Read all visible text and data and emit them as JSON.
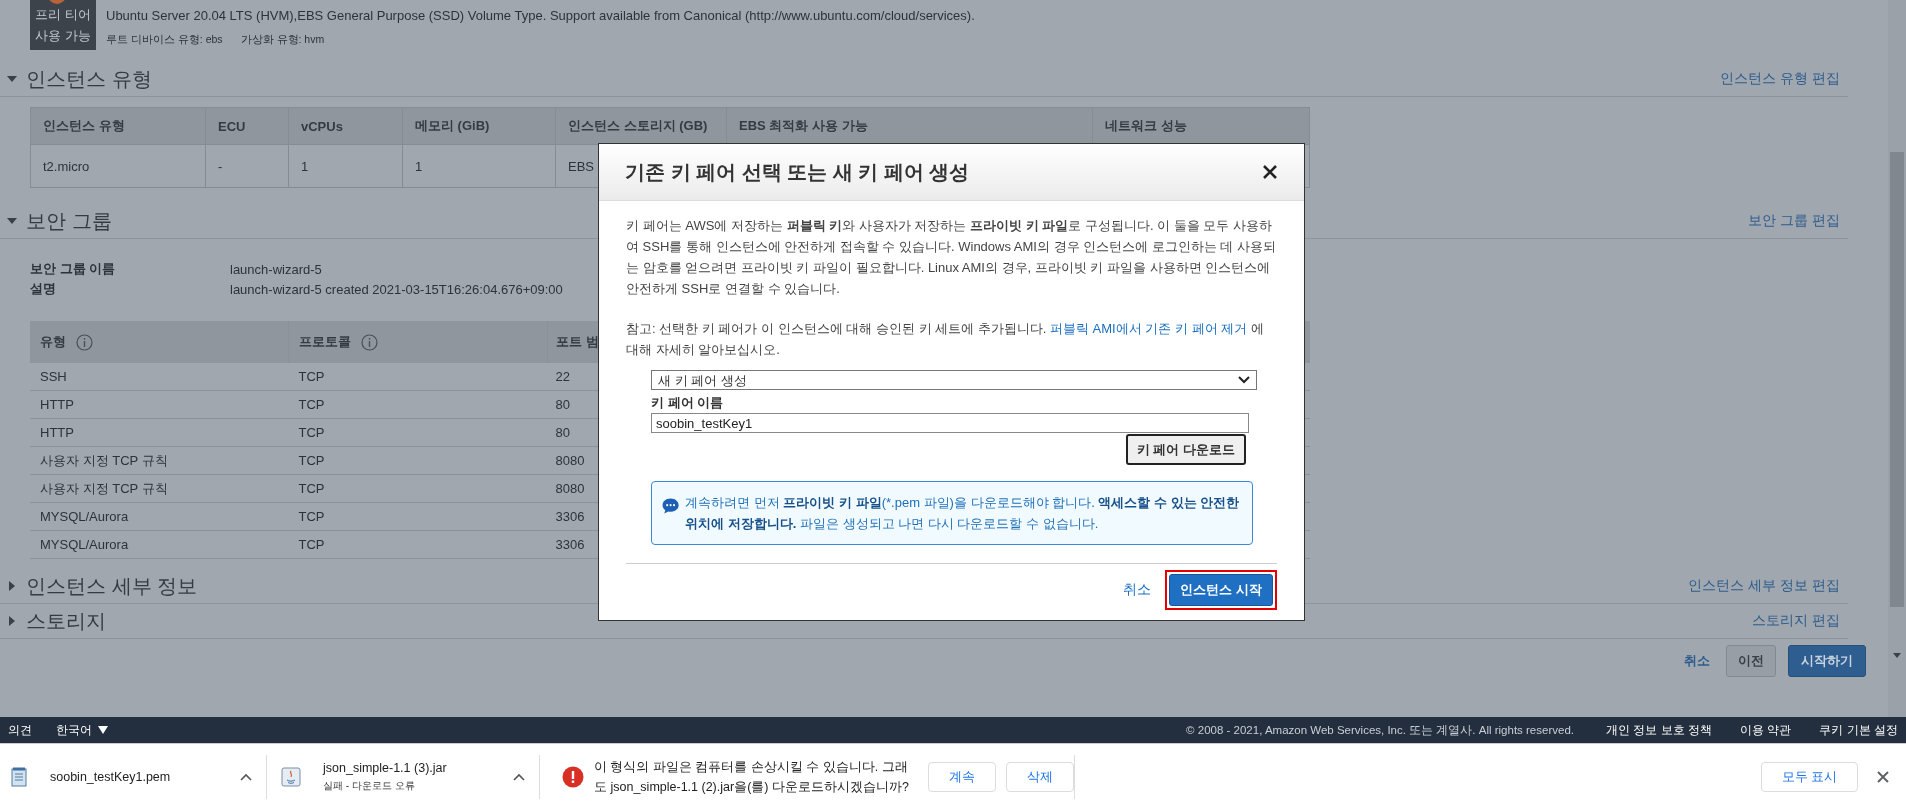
{
  "ami": {
    "badge": [
      "프리 티어",
      "사용 가능"
    ],
    "description": "Ubuntu Server 20.04 LTS (HVM),EBS General Purpose (SSD) Volume Type. Support available from Canonical (http://www.ubuntu.com/cloud/services).",
    "meta": [
      "루트 디바이스 유형: ebs",
      "가상화 유형: hvm"
    ]
  },
  "sections": [
    {
      "kind": "instance_type",
      "title": "인스턴스 유형",
      "expanded": true,
      "edit_link": "인스턴스 유형 편집",
      "table": {
        "columns": [
          "인스턴스 유형",
          "ECU",
          "vCPUs",
          "메모리 (GiB)",
          "인스턴스 스토리지 (GB)",
          "EBS 최적화 사용 가능",
          "네트워크 성능"
        ],
        "rows": [
          [
            "t2.micro",
            "-",
            "1",
            "1",
            "EBS"
          ]
        ]
      }
    },
    {
      "kind": "security_group",
      "title": "보안 그룹",
      "expanded": true,
      "edit_link": "보안 그룹 편집",
      "info": [
        {
          "label": "보안 그룹 이름",
          "value": "launch-wizard-5"
        },
        {
          "label": "설명",
          "value": "launch-wizard-5 created 2021-03-15T16:26:04.676+09:00"
        }
      ],
      "table": {
        "columns": [
          {
            "label": "유형",
            "info": true
          },
          {
            "label": "프로토콜",
            "info": true
          },
          {
            "label": "포트 범",
            "info": false
          }
        ],
        "rows": [
          [
            "SSH",
            "TCP",
            "22"
          ],
          [
            "HTTP",
            "TCP",
            "80"
          ],
          [
            "HTTP",
            "TCP",
            "80"
          ],
          [
            "사용자 지정 TCP 규칙",
            "TCP",
            "8080"
          ],
          [
            "사용자 지정 TCP 규칙",
            "TCP",
            "8080"
          ],
          [
            "MYSQL/Aurora",
            "TCP",
            "3306"
          ],
          [
            "MYSQL/Aurora",
            "TCP",
            "3306"
          ]
        ]
      }
    },
    {
      "title": "인스턴스 세부 정보",
      "expanded": false,
      "edit_link": "인스턴스 세부 정보 편집"
    },
    {
      "title": "스토리지",
      "expanded": false,
      "edit_link": "스토리지 편집"
    }
  ],
  "wizard_buttons": {
    "cancel": "취소",
    "previous": "이전",
    "launch": "시작하기"
  },
  "modal": {
    "title": "기존 키 페어 선택 또는 새 키 페어 생성",
    "intro": "키 페어는 AWS에 저장하는 **퍼블릭 키**와 사용자가 저장하는 **프라이빗 키 파일**로 구성됩니다. 이 둘을 모두 사용하여 SSH를 통해 인스턴스에 안전하게 접속할 수 있습니다. Windows AMI의 경우 인스턴스에 로그인하는 데 사용되는 암호를 얻으려면 프라이빗 키 파일이 필요합니다. Linux AMI의 경우, 프라이빗 키 파일을 사용하면 인스턴스에 안전하게 SSH로 연결할 수 있습니다.",
    "note": {
      "before": "참고: 선택한 키 페어가 이 인스턴스에 대해 승인된 키 세트에 추가됩니다.",
      "link": "퍼블릭 AMI에서 기존 키 페어 제거",
      "after": "에 대해 자세히 알아보십시오."
    },
    "key_pair_select": {
      "value": "새 키 페어 생성"
    },
    "name_label": "키 페어 이름",
    "name_field": {
      "value": "soobin_testKey1"
    },
    "download_button": "키 페어 다운로드",
    "info": [
      {
        "text": "계속하려면 먼저 ",
        "bold": false
      },
      {
        "text": "프라이빗 키 파일",
        "bold": true
      },
      {
        "text": "(*.pem 파일)을 다운로드해야 합니다. ",
        "bold": false
      },
      {
        "text": "액세스할 수 있는 안전한 위치에 저장합니다.",
        "bold": true
      },
      {
        "text": " 파일은 생성되고 나면 다시 다운로드할 수 없습니다.",
        "bold": false
      }
    ],
    "cancel": "취소",
    "launch": "인스턴스 시작",
    "launch_highlighted": true
  },
  "footer": {
    "feedback": "의견",
    "language": "한국어",
    "copyright": "© 2008 - 2021, Amazon Web Services, Inc. 또는 계열사. All rights reserved.",
    "links": [
      "개인 정보 보호 정책",
      "이용 약관",
      "쿠키 기본 설정"
    ]
  },
  "downloads": {
    "items": [
      {
        "kind": "text",
        "name": "soobin_testKey1.pem"
      },
      {
        "kind": "jar",
        "name": "json_simple-1.1 (3).jar",
        "status": "실패 - 다운로드 오류"
      }
    ],
    "warning": {
      "message": "이 형식의 파일은 컴퓨터를 손상시킬 수 있습니다. 그래도 json_simple-1.1 (2).jar을(를) 다운로드하시겠습니까?",
      "buttons": [
        "계속",
        "삭제"
      ]
    },
    "show_all": "모두 표시"
  }
}
